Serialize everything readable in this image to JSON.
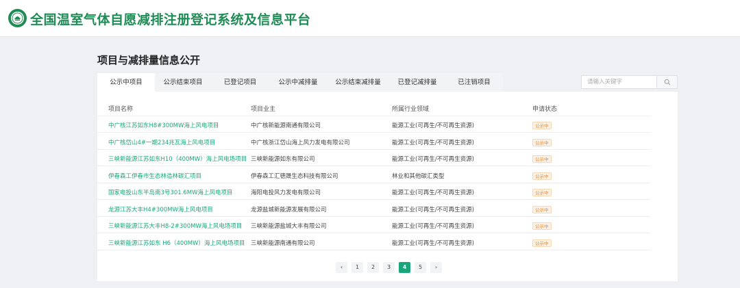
{
  "header": {
    "title": "全国温室气体自愿减排注册登记系统及信息平台",
    "logo_icon": "emblem-logo-icon"
  },
  "section_title": "项目与减排量信息公开",
  "tabs": [
    {
      "label": "公示中项目",
      "active": true
    },
    {
      "label": "公示结束项目",
      "active": false
    },
    {
      "label": "已登记项目",
      "active": false
    },
    {
      "label": "公示中减排量",
      "active": false
    },
    {
      "label": "公示结束减排量",
      "active": false
    },
    {
      "label": "已登记减排量",
      "active": false
    },
    {
      "label": "已注销项目",
      "active": false
    }
  ],
  "search": {
    "placeholder": "请输入关键字",
    "icon": "search-icon"
  },
  "table": {
    "columns": [
      "项目名称",
      "项目业主",
      "所属行业领域",
      "申请状态"
    ],
    "rows": [
      {
        "name": "中广核江苏如东H8#300MW海上风电项目",
        "owner": "中广核新能源南通有限公司",
        "field": "能源工业(可再生/不可再生资源)",
        "status": "公示中"
      },
      {
        "name": "中广核岱山4#一期234兆瓦海上风电项目",
        "owner": "中广核浙江岱山海上风力发电有限公司",
        "field": "能源工业(可再生/不可再生资源)",
        "status": "公示中"
      },
      {
        "name": "三峡新能源江苏如东H10（400MW）海上风电场项目",
        "owner": "三峡新能源如东有限公司",
        "field": "能源工业(可再生/不可再生资源)",
        "status": "公示中"
      },
      {
        "name": "伊春森工伊春市生态林造林碳汇项目",
        "owner": "伊春森工汇德晟生态科技有限公司",
        "field": "林业和其他碳汇类型",
        "status": "公示中"
      },
      {
        "name": "国家电投山东半岛南3号301.6MW海上风电项目",
        "owner": "海阳电投风力发电有限公司",
        "field": "能源工业(可再生/不可再生资源)",
        "status": "公示中"
      },
      {
        "name": "龙源江苏大丰H4#300MW海上风电项目",
        "owner": "龙源盐城新能源发展有限公司",
        "field": "能源工业(可再生/不可再生资源)",
        "status": "公示中"
      },
      {
        "name": "三峡新能源江苏大丰H8-2#300MW海上风电场项目",
        "owner": "三峡新能源盐城大丰有限公司",
        "field": "能源工业(可再生/不可再生资源)",
        "status": "公示中"
      },
      {
        "name": "三峡新能源江苏如东 H6（400MW）海上风电场项目",
        "owner": "三峡新能源南通有限公司",
        "field": "能源工业(可再生/不可再生资源)",
        "status": "公示中"
      }
    ]
  },
  "pagination": {
    "prev": "‹",
    "pages": [
      "1",
      "2",
      "3",
      "4",
      "5"
    ],
    "current": "4",
    "next": "›"
  },
  "colors": {
    "brand_green": "#1e8c55",
    "link_teal": "#1aa57a",
    "badge_orange": "#e08a3c"
  }
}
